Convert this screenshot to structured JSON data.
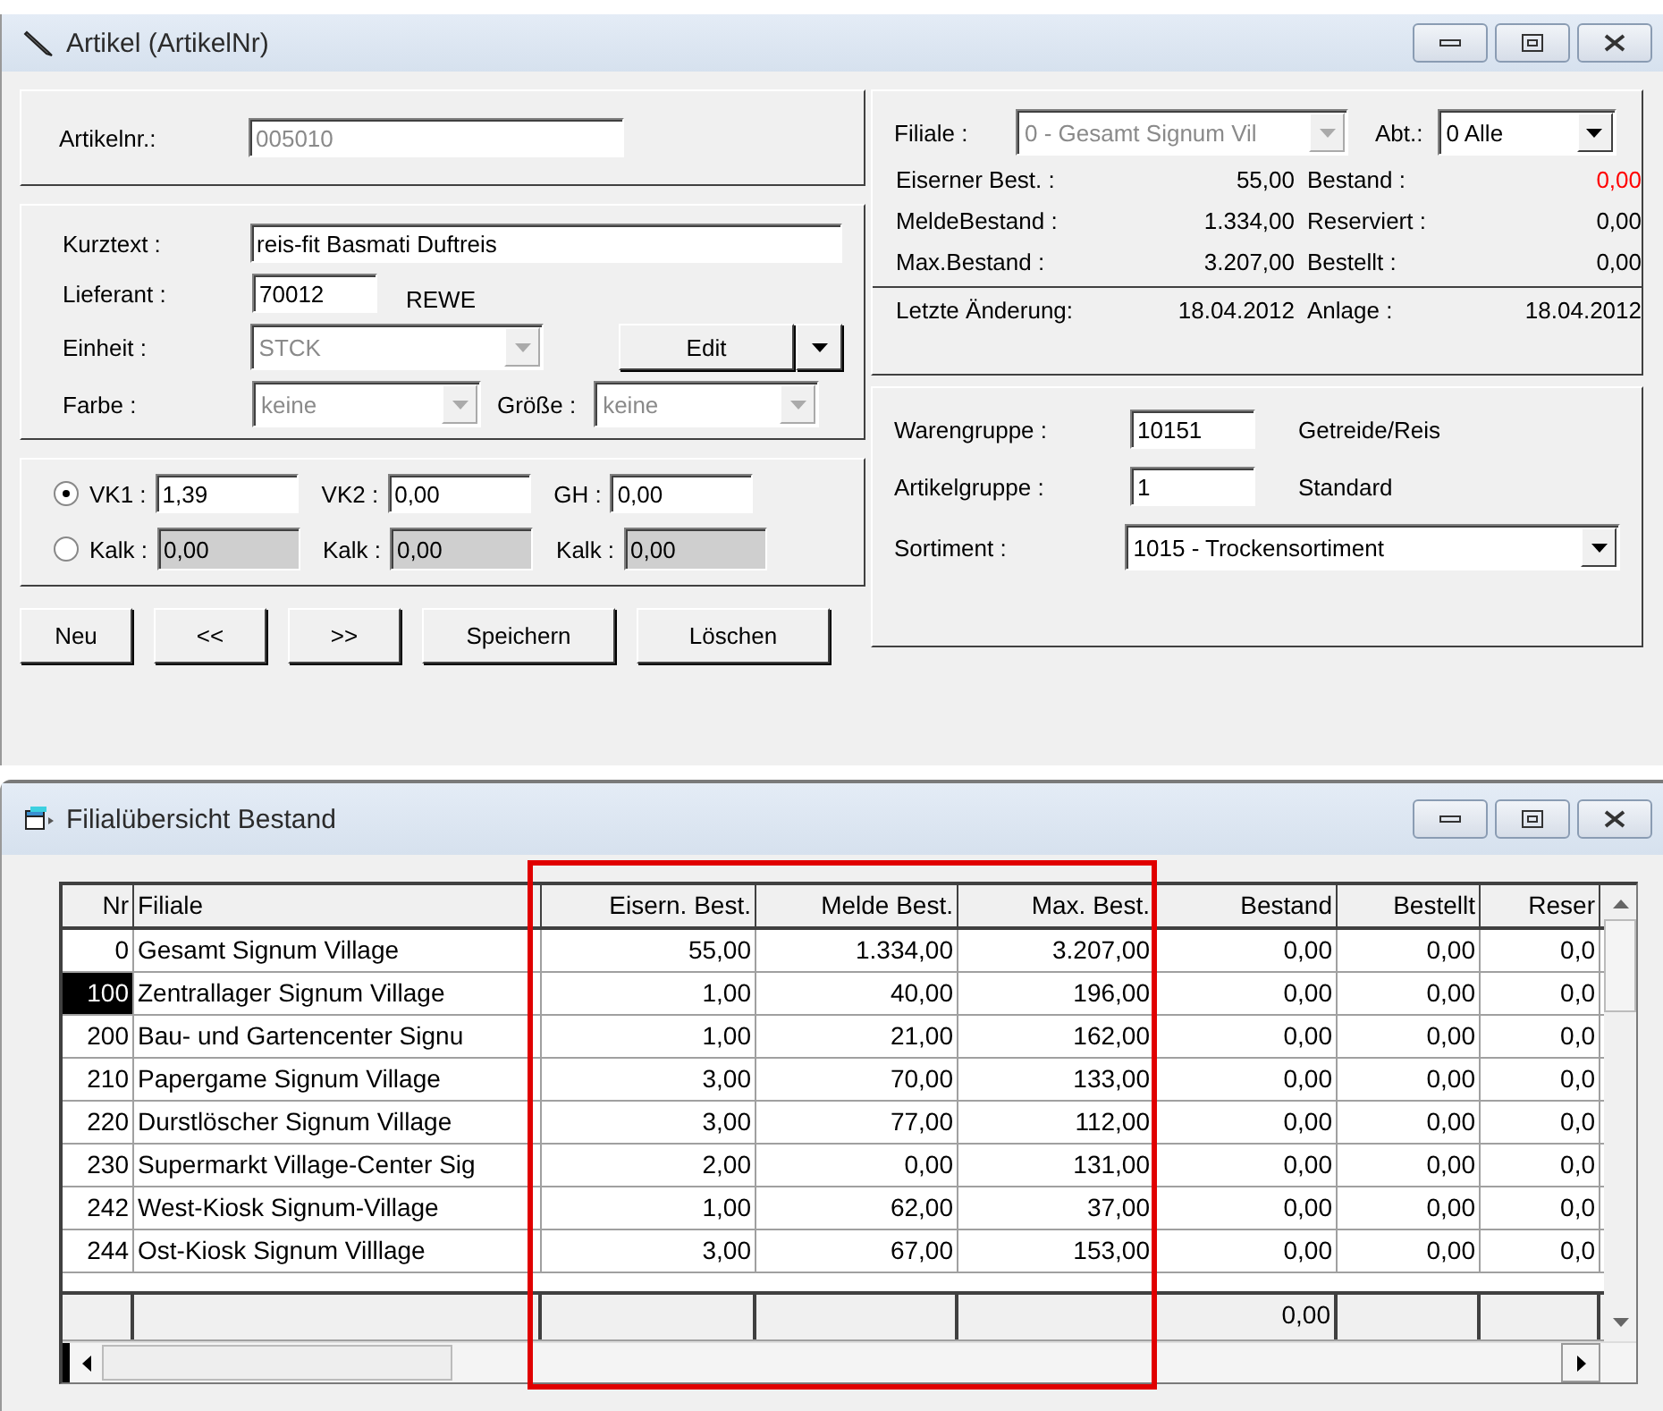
{
  "window": {
    "title": "Artikel  (ArtikelNr)"
  },
  "artikel_nr": {
    "label": "Artikelnr.:",
    "value": "005010",
    "disabled": true
  },
  "details": {
    "kurztext": {
      "label": "Kurztext :",
      "value": "reis-fit Basmati Duftreis"
    },
    "lieferant": {
      "label": "Lieferant :",
      "value": "70012",
      "name": "REWE"
    },
    "einheit": {
      "label": "Einheit :",
      "value": "STCK",
      "disabled": true
    },
    "edit_button": "Edit",
    "farbe": {
      "label": "Farbe :",
      "value": "keine",
      "disabled": true
    },
    "groesse": {
      "label": "Größe :",
      "value": "keine",
      "disabled": true
    }
  },
  "price_rows": [
    {
      "selected": true,
      "readonly": false,
      "fields": [
        {
          "label": "VK1 :",
          "value": "1,39"
        },
        {
          "label": "VK2 :",
          "value": "0,00"
        },
        {
          "label": "GH :",
          "value": "0,00"
        }
      ]
    },
    {
      "selected": false,
      "readonly": true,
      "fields": [
        {
          "label": "Kalk :",
          "value": "0,00"
        },
        {
          "label": "Kalk :",
          "value": "0,00"
        },
        {
          "label": "Kalk :",
          "value": "0,00"
        }
      ]
    }
  ],
  "buttons": [
    "Neu",
    "<<",
    ">>",
    "Speichern",
    "Löschen"
  ],
  "stock": {
    "filiale": {
      "label": "Filiale :",
      "value": "0 - Gesamt Signum Vil",
      "disabled": true
    },
    "abt": {
      "label": "Abt.:",
      "value": "0 Alle"
    },
    "stats": [
      {
        "label": "Eiserner Best. :",
        "value": "55,00",
        "warning": false
      },
      {
        "label": "Bestand :",
        "value": "0,00",
        "warning": true
      },
      {
        "label": "MeldeBestand :",
        "value": "1.334,00",
        "warning": false
      },
      {
        "label": "Reserviert :",
        "value": "0,00",
        "warning": false
      },
      {
        "label": "Max.Bestand :",
        "value": "3.207,00",
        "warning": false
      },
      {
        "label": "Bestellt :",
        "value": "0,00",
        "warning": false
      }
    ],
    "changed": {
      "label": "Letzte Änderung:",
      "value": "18.04.2012"
    },
    "created": {
      "label": "Anlage :",
      "value": "18.04.2012"
    }
  },
  "groups": {
    "warengruppe": {
      "label": "Warengruppe :",
      "code": "10151",
      "name": "Getreide/Reis"
    },
    "artikelgruppe": {
      "label": "Artikelgruppe :",
      "code": "1",
      "name": "Standard"
    },
    "sortiment": {
      "label": "Sortiment :",
      "value": "1015 - Trockensortiment"
    }
  },
  "overview": {
    "title": "Filialübersicht Bestand",
    "columns": [
      "Nr",
      "Filiale",
      "Eisern. Best.",
      "Melde Best.",
      "Max. Best.",
      "Bestand",
      "Bestellt",
      "Reser"
    ],
    "rows": [
      {
        "selected": false,
        "cells": [
          "0",
          "Gesamt Signum Village",
          "55,00",
          "1.334,00",
          "3.207,00",
          "0,00",
          "0,00",
          "0,0"
        ]
      },
      {
        "selected": true,
        "cells": [
          "100",
          "Zentrallager Signum Village",
          "1,00",
          "40,00",
          "196,00",
          "0,00",
          "0,00",
          "0,0"
        ]
      },
      {
        "selected": false,
        "cells": [
          "200",
          "Bau- und Gartencenter Signu",
          "1,00",
          "21,00",
          "162,00",
          "0,00",
          "0,00",
          "0,0"
        ]
      },
      {
        "selected": false,
        "cells": [
          "210",
          "Papergame Signum Village",
          "3,00",
          "70,00",
          "133,00",
          "0,00",
          "0,00",
          "0,0"
        ]
      },
      {
        "selected": false,
        "cells": [
          "220",
          "Durstlöscher Signum Village",
          "3,00",
          "77,00",
          "112,00",
          "0,00",
          "0,00",
          "0,0"
        ]
      },
      {
        "selected": false,
        "cells": [
          "230",
          "Supermarkt Village-Center Sig",
          "2,00",
          "0,00",
          "131,00",
          "0,00",
          "0,00",
          "0,0"
        ]
      },
      {
        "selected": false,
        "cells": [
          "242",
          "West-Kiosk Signum-Village",
          "1,00",
          "62,00",
          "37,00",
          "0,00",
          "0,00",
          "0,0"
        ]
      },
      {
        "selected": false,
        "cells": [
          "244",
          "Ost-Kiosk Signum Villlage",
          "3,00",
          "67,00",
          "153,00",
          "0,00",
          "0,00",
          "0,0"
        ]
      }
    ],
    "footer_bestand": "0,00"
  }
}
